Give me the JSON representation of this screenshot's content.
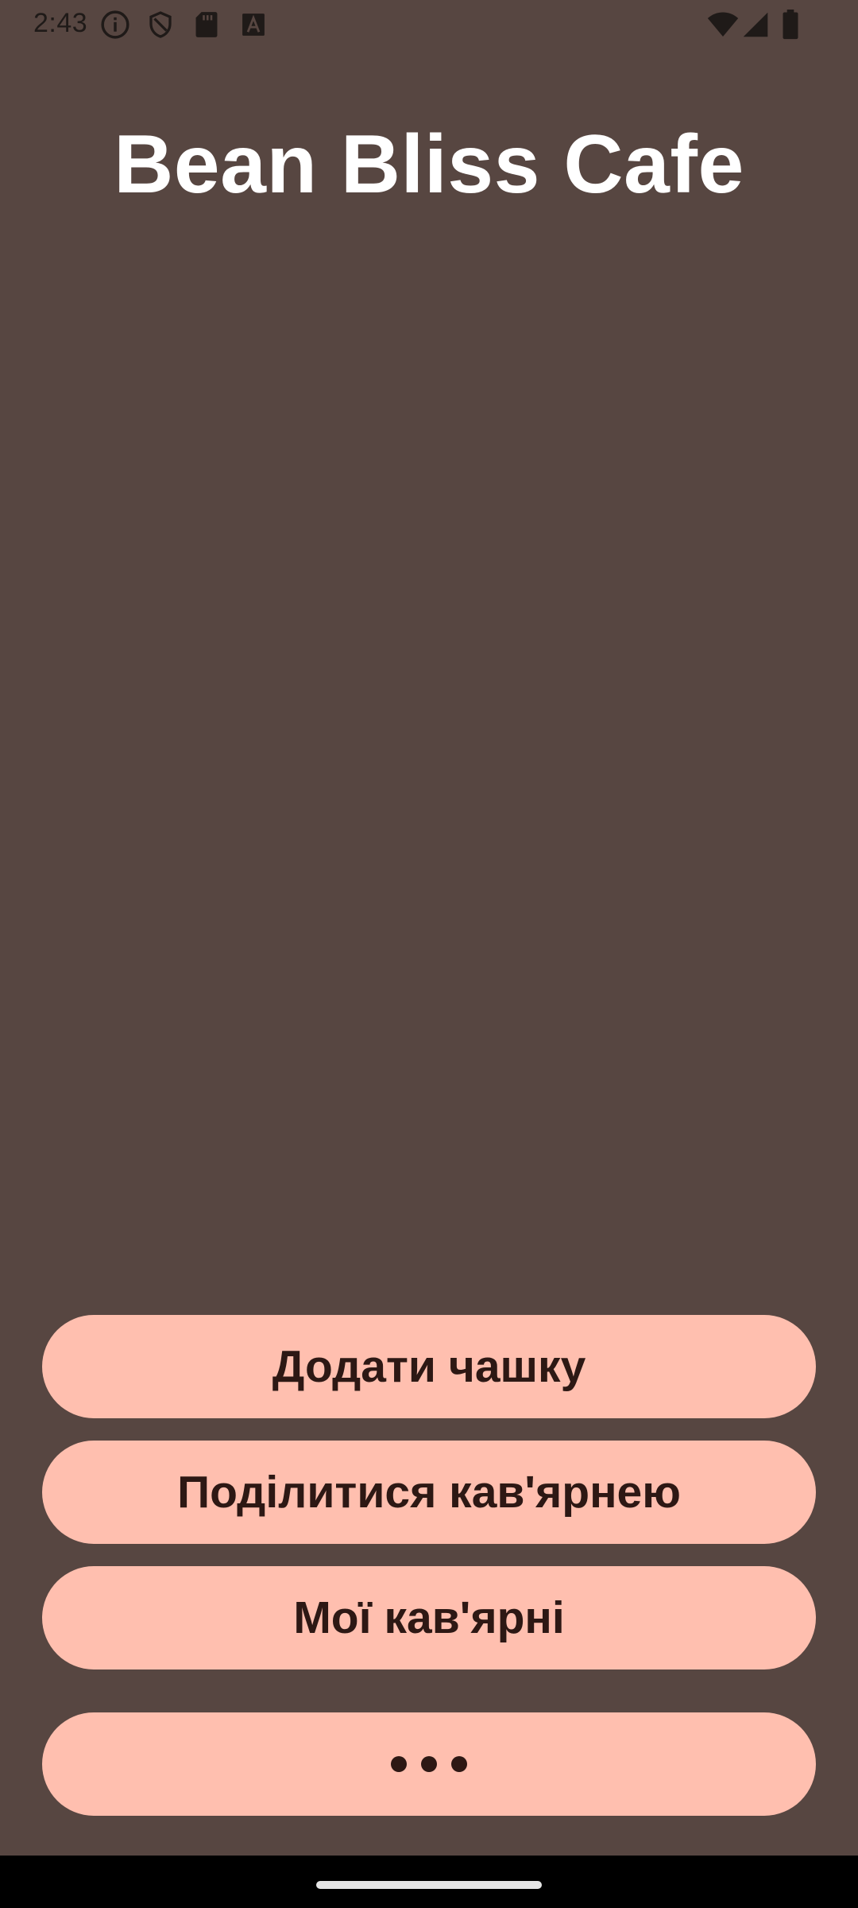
{
  "status_bar": {
    "time": "2:43",
    "left_icons": [
      "info-icon",
      "shield-icon",
      "sd-card-icon",
      "font-a-icon"
    ],
    "right_icons": [
      "wifi-icon",
      "cell-signal-icon",
      "battery-icon"
    ]
  },
  "app": {
    "title": "Bean Bliss Cafe"
  },
  "actions": {
    "add_cup": "Додати чашку",
    "share_cafe": "Поділитися кав'ярнею",
    "my_cafes": "Мої кав'ярні",
    "more_icon": "more-horizontal-icon"
  },
  "colors": {
    "background": "#574641",
    "button_bg": "#ffbfaf",
    "button_text": "#2d1814",
    "title_text": "#ffffff"
  }
}
